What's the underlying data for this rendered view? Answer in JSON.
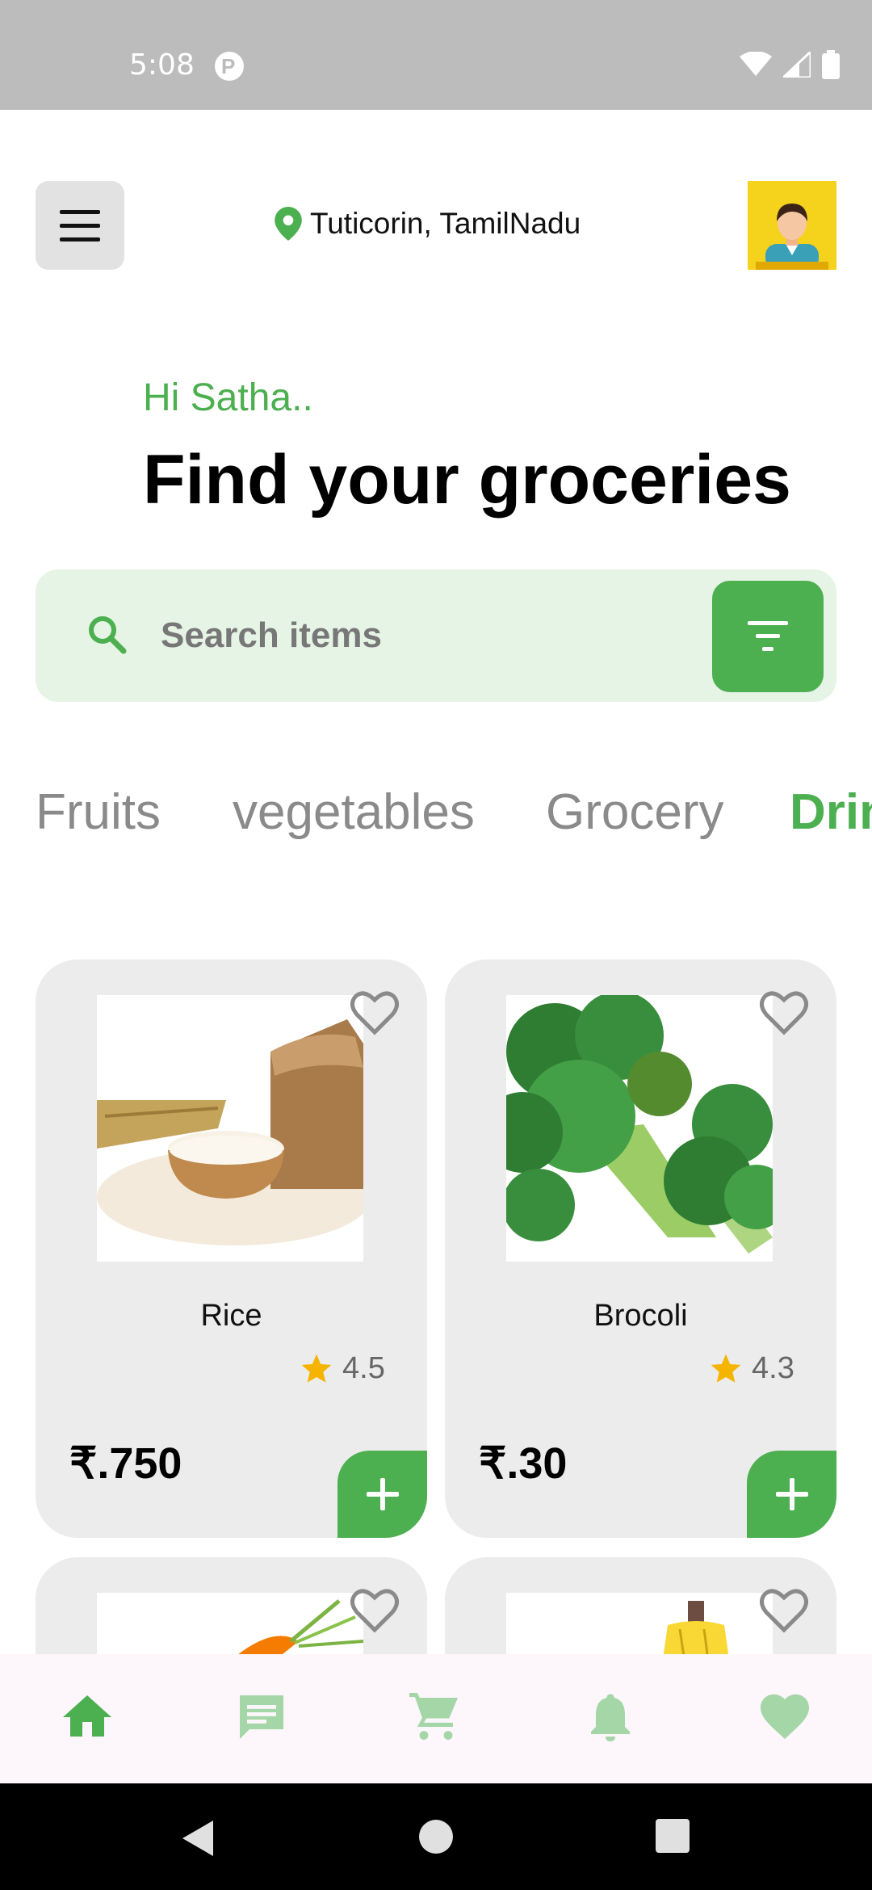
{
  "status_bar": {
    "time": "5:08",
    "icons": [
      "p-badge-icon",
      "wifi-icon",
      "signal-icon",
      "battery-icon"
    ]
  },
  "header": {
    "menu_icon": "hamburger-menu-icon",
    "location_icon": "location-pin-icon",
    "location": "Tuticorin, TamilNadu",
    "avatar_icon": "user-avatar-icon"
  },
  "greeting": "Hi Satha..",
  "headline": "Find your groceries",
  "search": {
    "placeholder": "Search items",
    "value": "",
    "search_icon": "search-icon",
    "filter_icon": "filter-icon"
  },
  "categories": [
    {
      "label": "Fruits",
      "active": false
    },
    {
      "label": "vegetables",
      "active": false
    },
    {
      "label": "Grocery",
      "active": false
    },
    {
      "label": "Drin",
      "active": true
    }
  ],
  "products": [
    {
      "name": "Rice",
      "rating": "4.5",
      "price": "₹.750",
      "image_icon": "rice-image"
    },
    {
      "name": "Brocoli",
      "rating": "4.3",
      "price": "₹.30",
      "image_icon": "broccoli-image"
    },
    {
      "name": "",
      "rating": "",
      "price": "",
      "image_icon": "carrot-image"
    },
    {
      "name": "",
      "rating": "",
      "price": "",
      "image_icon": "banana-image"
    }
  ],
  "bottom_nav": [
    {
      "icon": "home-icon",
      "active": true
    },
    {
      "icon": "chat-icon",
      "active": false
    },
    {
      "icon": "cart-icon",
      "active": false
    },
    {
      "icon": "bell-icon",
      "active": false
    },
    {
      "icon": "heart-icon",
      "active": false
    }
  ],
  "system_nav": [
    "back-icon",
    "home-circle-icon",
    "recents-icon"
  ],
  "colors": {
    "accent": "#4caf50",
    "accent_light": "#e6f4e6",
    "card_bg": "#ececec",
    "nav_inactive": "#a5d6a7",
    "star": "#f4b400"
  }
}
